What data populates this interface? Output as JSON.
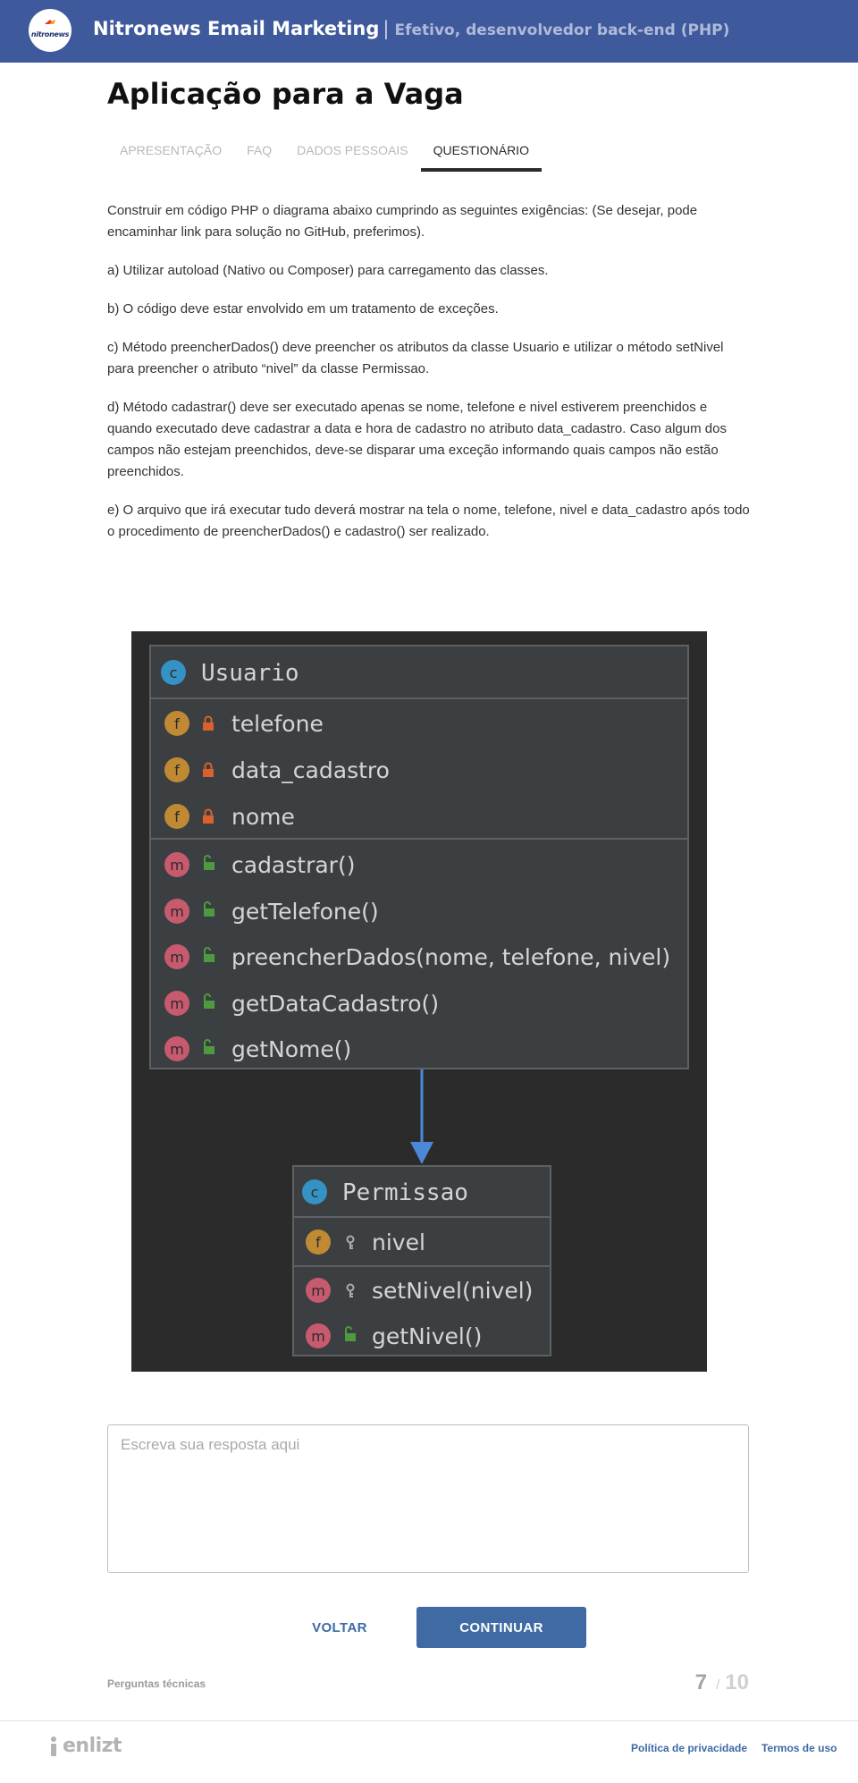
{
  "header": {
    "logo_text": "nitronews",
    "company": "Nitronews Email Marketing",
    "separator": "|",
    "job_title": "Efetivo, desenvolvedor back-end (PHP)",
    "bg_color": "#3f5a9c"
  },
  "page": {
    "title": "Aplicação para a Vaga"
  },
  "tabs": [
    {
      "label": "APRESENTAÇÃO",
      "active": false
    },
    {
      "label": "FAQ",
      "active": false
    },
    {
      "label": "DADOS PESSOAIS",
      "active": false
    },
    {
      "label": "QUESTIONÁRIO",
      "active": true
    }
  ],
  "question": {
    "paragraphs": [
      "Construir em código PHP o diagrama abaixo cumprindo as seguintes exigências: (Se desejar, pode encaminhar link para solução no GitHub, preferimos).",
      "a) Utilizar autoload (Nativo ou Composer) para carregamento das classes.",
      "b) O código deve estar envolvido em um tratamento de exceções.",
      "c) Método preencherDados() deve preencher os atributos da classe Usuario e utilizar o método setNivel para preencher o atributo “nivel” da classe Permissao.",
      "d) Método cadastrar() deve ser executado apenas se nome, telefone e nivel estiverem preenchidos e quando executado deve cadastrar a data e hora de cadastro no atributo data_cadastro. Caso algum dos campos não estejam preenchidos, deve-se disparar uma exceção informando quais campos não estão preenchidos.",
      "e) O arquivo que irá executar tudo deverá mostrar na tela o nome, telefone, nivel e data_cadastro após todo o procedimento de preencherDados() e cadastro() ser realizado."
    ]
  },
  "diagram": {
    "class_usuario": {
      "badge": "c",
      "name": "Usuario",
      "fields": [
        {
          "badge": "f",
          "icon": "lock-icon",
          "name": "telefone"
        },
        {
          "badge": "f",
          "icon": "lock-icon",
          "name": "data_cadastro"
        },
        {
          "badge": "f",
          "icon": "lock-icon",
          "name": "nome"
        }
      ],
      "methods": [
        {
          "badge": "m",
          "icon": "unlock-icon",
          "name": "cadastrar()"
        },
        {
          "badge": "m",
          "icon": "unlock-icon",
          "name": "getTelefone()"
        },
        {
          "badge": "m",
          "icon": "unlock-icon",
          "name": "preencherDados(nome, telefone, nivel)"
        },
        {
          "badge": "m",
          "icon": "unlock-icon",
          "name": "getDataCadastro()"
        },
        {
          "badge": "m",
          "icon": "unlock-icon",
          "name": "getNome()"
        }
      ]
    },
    "class_permissao": {
      "badge": "c",
      "name": "Permissao",
      "fields": [
        {
          "badge": "f",
          "icon": "key-icon",
          "name": "nivel"
        }
      ],
      "methods": [
        {
          "badge": "m",
          "icon": "key-icon",
          "name": "setNivel(nivel)"
        },
        {
          "badge": "m",
          "icon": "unlock-icon",
          "name": "getNivel()"
        }
      ]
    },
    "colors": {
      "background": "#2b2b2b",
      "class_box": "#3c3f41",
      "class_border": "#5e6163",
      "text": "#d3d6d8",
      "badge_c": "#3592c4",
      "badge_f": "#c08a35",
      "badge_m": "#c75a6e",
      "lock": "#d8612e",
      "unlock": "#4e9a3e",
      "arrow": "#4b88d8"
    }
  },
  "answer": {
    "placeholder": "Escreva sua resposta aqui",
    "value": ""
  },
  "buttons": {
    "back": "VOLTAR",
    "next": "CONTINUAR"
  },
  "footer_info": {
    "section": "Perguntas técnicas",
    "current": "7",
    "separator": "/",
    "total": "10"
  },
  "footer": {
    "brand": "enlizt",
    "privacy": "Política de privacidade",
    "terms": "Termos de uso"
  }
}
